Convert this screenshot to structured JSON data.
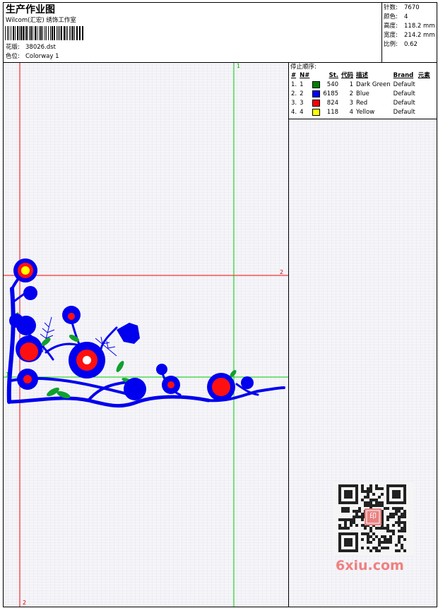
{
  "header": {
    "title": "生产作业图",
    "company": "Wilcom(汇宏) 绣饰工作室",
    "design_label": "花版:",
    "design_value": "38026.dst",
    "colorway_label": "色位:",
    "colorway_value": "Colorway 1"
  },
  "stats": [
    {
      "label": "针数:",
      "value": "7670"
    },
    {
      "label": "颜色:",
      "value": "4"
    },
    {
      "label": "高度:",
      "value": "118.2 mm"
    },
    {
      "label": "宽度:",
      "value": "214.2 mm"
    },
    {
      "label": "比例:",
      "value": "0.62"
    }
  ],
  "stop_sequence": {
    "title": "停止顺序:",
    "columns": [
      "#",
      "N#",
      "St.",
      "代码",
      "描述",
      "Brand",
      "元素"
    ],
    "rows": [
      {
        "num": "1.",
        "n": "1",
        "color": "#008000",
        "st": "540",
        "code": "1",
        "desc": "Dark Green",
        "brand": "Default"
      },
      {
        "num": "2.",
        "n": "2",
        "color": "#0000ff",
        "st": "6185",
        "code": "2",
        "desc": "Blue",
        "brand": "Default"
      },
      {
        "num": "3.",
        "n": "3",
        "color": "#ff0000",
        "st": "824",
        "code": "3",
        "desc": "Red",
        "brand": "Default"
      },
      {
        "num": "4.",
        "n": "4",
        "color": "#ffff00",
        "st": "118",
        "code": "4",
        "desc": "Yellow",
        "brand": "Default"
      }
    ]
  },
  "guides": {
    "green_top": "1",
    "green_left": "1",
    "red_right": "2",
    "red_bottom": "2"
  },
  "colors": {
    "guide_green": "#00cc00",
    "guide_red": "#ff0000",
    "thread_blue": "#0000ee",
    "thread_red": "#ff1010",
    "thread_green": "#10a030",
    "thread_yellow": "#ffff00"
  },
  "watermark": {
    "text": "6xiu.com",
    "seal": "印"
  }
}
